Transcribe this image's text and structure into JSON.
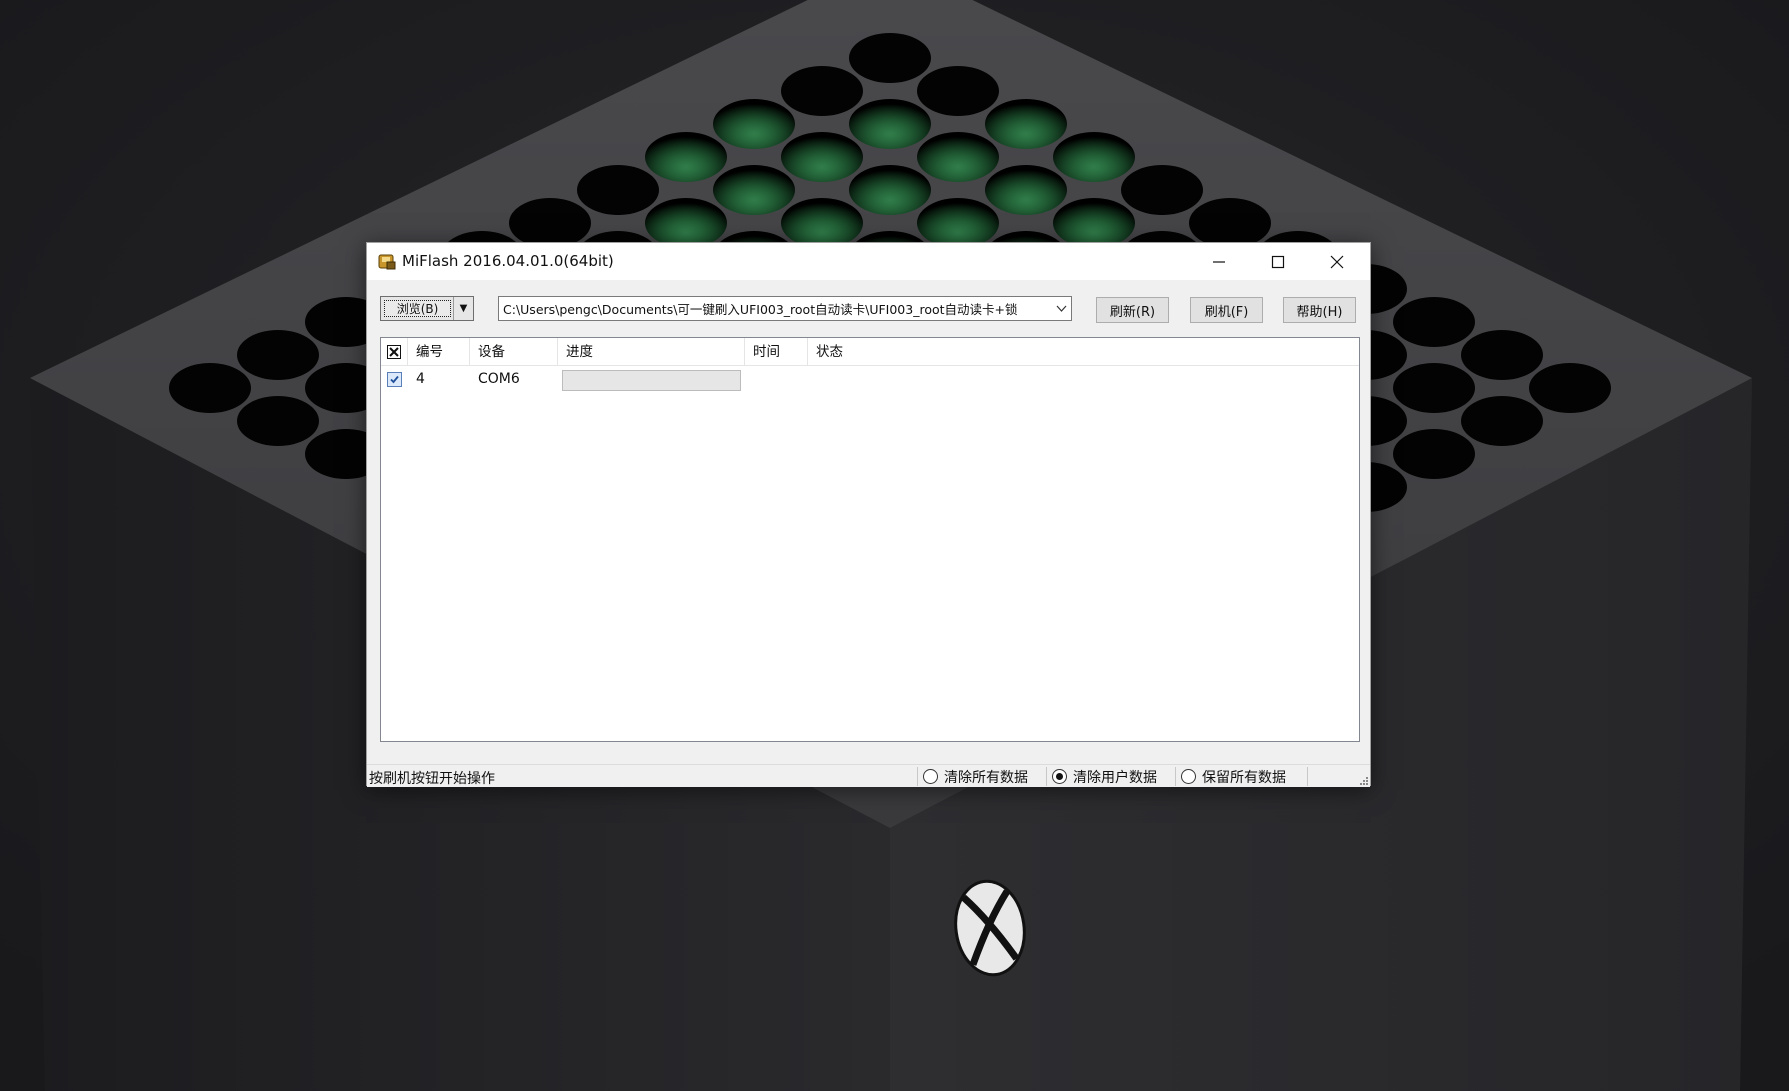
{
  "window": {
    "title": "MiFlash 2016.04.01.0(64bit)",
    "icon": "miflash-app-icon"
  },
  "toolbar": {
    "browse_label": "浏览(B)",
    "path_value": "C:\\Users\\pengc\\Documents\\可一键刷入UFI003_root自动读卡\\UFI003_root自动读卡+锁",
    "refresh_label": "刷新(R)",
    "flash_label": "刷机(F)",
    "help_label": "帮助(H)"
  },
  "device_list": {
    "columns": [
      "编号",
      "设备",
      "进度",
      "时间",
      "状态"
    ],
    "select_all_checked": true,
    "rows": [
      {
        "checked": true,
        "number": "4",
        "device": "COM6",
        "progress": 0,
        "time": "",
        "status": ""
      }
    ]
  },
  "statusbar": {
    "message": "按刷机按钮开始操作",
    "options": [
      {
        "label": "清除所有数据",
        "checked": false
      },
      {
        "label": "清除用户数据",
        "checked": true
      },
      {
        "label": "保留所有数据",
        "checked": false
      }
    ]
  },
  "colors": {
    "window_bg": "#f0f0f0",
    "progress_fill": "#06b025",
    "wallpaper_glow": "#1fa84a"
  }
}
